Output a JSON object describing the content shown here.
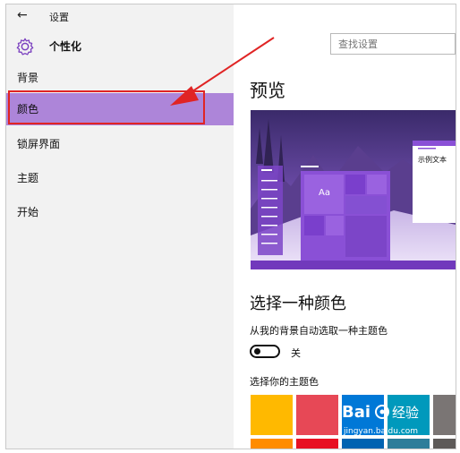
{
  "window": {
    "title": "设置",
    "back_icon": "back-arrow-icon"
  },
  "sidebar": {
    "header_title": "个性化",
    "header_icon": "gear-icon",
    "items": [
      {
        "label": "背景"
      },
      {
        "label": "颜色",
        "selected": true
      },
      {
        "label": "锁屏界面"
      },
      {
        "label": "主题"
      },
      {
        "label": "开始"
      }
    ]
  },
  "search": {
    "placeholder": "查找设置"
  },
  "main": {
    "preview_heading": "预览",
    "preview": {
      "tile_label": "Aa",
      "sample_text": "示例文本"
    },
    "color_heading": "选择一种颜色",
    "auto_label": "从我的背景自动选取一种主题色",
    "toggle_state": "关",
    "choose_label": "选择你的主题色",
    "swatch_colors": [
      "#ffb900",
      "#e74856",
      "#0078d7",
      "#0099bc",
      "#7a7574"
    ],
    "swatch_colors_row2": [
      "#ff8c00",
      "#e81123",
      "#0063b1",
      "#2d7d9a",
      "#5d5a58"
    ]
  },
  "watermark": {
    "brand": "Bai",
    "brand2": "经验",
    "url": "jingyan.baidu.com"
  },
  "colors": {
    "accent": "#ad85d9",
    "annotation": "#e02424",
    "sidebar_bg": "#f2f2f2"
  }
}
